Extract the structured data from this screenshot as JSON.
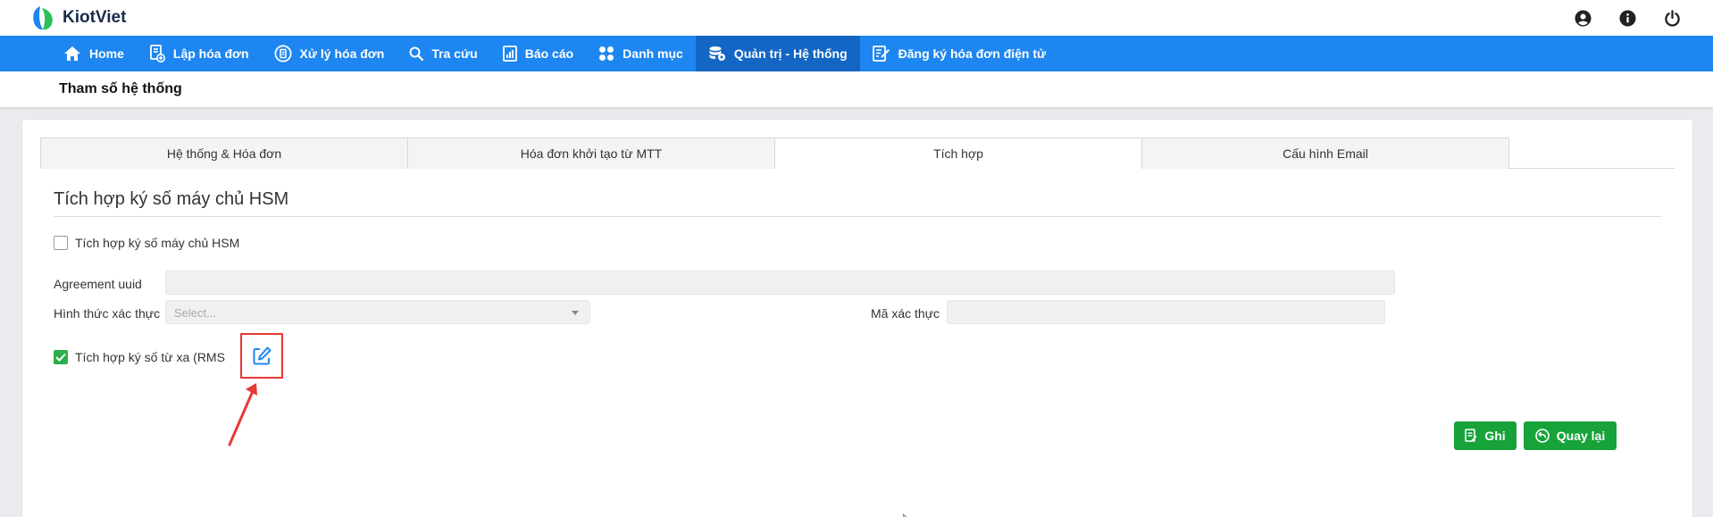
{
  "app": {
    "brand": "KiotViet"
  },
  "nav": {
    "items": [
      {
        "label": "Home",
        "icon": "home-icon"
      },
      {
        "label": "Lập hóa đơn",
        "icon": "invoice-add-icon"
      },
      {
        "label": "Xử lý hóa đơn",
        "icon": "invoice-process-icon"
      },
      {
        "label": "Tra cứu",
        "icon": "search-icon"
      },
      {
        "label": "Báo cáo",
        "icon": "report-icon"
      },
      {
        "label": "Danh mục",
        "icon": "grid-icon"
      },
      {
        "label": "Quản trị - Hệ thống",
        "icon": "admin-icon"
      },
      {
        "label": "Đăng ký hóa đơn điện tử",
        "icon": "register-icon"
      }
    ],
    "active_index": 6
  },
  "top_icons": [
    "user-circle-icon",
    "info-icon",
    "power-icon"
  ],
  "page": {
    "title": "Tham số hệ thống"
  },
  "tabs": [
    {
      "label": "Hệ thống & Hóa đơn"
    },
    {
      "label": "Hóa đơn khởi tạo từ MTT"
    },
    {
      "label": "Tích hợp"
    },
    {
      "label": "Cấu hình Email"
    }
  ],
  "active_tab": 2,
  "section": {
    "title": "Tích hợp ký số máy chủ HSM"
  },
  "hsm": {
    "checkbox_label": "Tích hợp ký số máy chủ HSM",
    "checked": false,
    "agreement_label": "Agreement uuid",
    "agreement_value": "",
    "auth_method_label": "Hình thức xác thực",
    "auth_method_placeholder": "Select...",
    "auth_code_label": "Mã xác thực",
    "auth_code_value": ""
  },
  "rms": {
    "checkbox_label": "Tích hợp ký số từ xa (RMS",
    "checked": true
  },
  "actions": {
    "save_label": "Ghi",
    "back_label": "Quay lại"
  },
  "colors": {
    "nav_bg": "#1e86f0",
    "nav_active": "#1366c4",
    "button_green": "#18a33a",
    "checkbox_green": "#2bae4a",
    "annotation_red": "#e53935"
  }
}
